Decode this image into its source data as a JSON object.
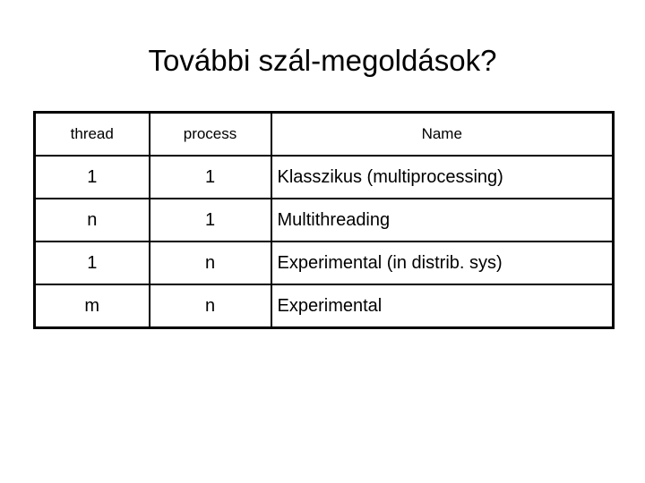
{
  "slide": {
    "title": "További szál-megoldások?",
    "background_color": "#ffffff",
    "text_color": "#000000",
    "border_color": "#000000"
  },
  "table": {
    "headers": {
      "thread": "thread",
      "process": "process",
      "name": "Name"
    },
    "rows": [
      {
        "thread": "1",
        "process": "1",
        "name": "Klasszikus (multiprocessing)"
      },
      {
        "thread": "n",
        "process": "1",
        "name": "Multithreading"
      },
      {
        "thread": "1",
        "process": "n",
        "name": "Experimental (in distrib. sys)"
      },
      {
        "thread": "m",
        "process": "n",
        "name": "Experimental"
      }
    ]
  }
}
